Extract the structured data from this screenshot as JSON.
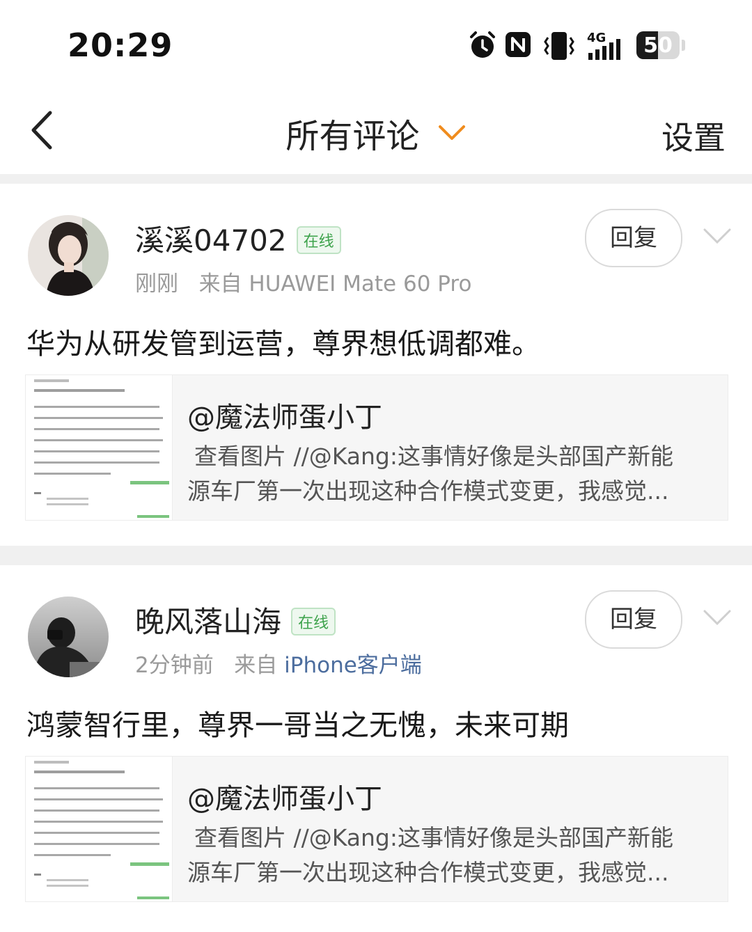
{
  "status_bar": {
    "time": "20:29",
    "network": "4G",
    "battery": "50",
    "battery_level_percent": 50,
    "icons": [
      "alarm-icon",
      "nfc-icon",
      "vibrate-icon",
      "signal-icon",
      "battery-icon"
    ]
  },
  "nav": {
    "back_icon": "chevron-left-icon",
    "title": "所有评论",
    "title_dropdown_icon": "chevron-down-icon",
    "dropdown_color": "#f08c1e",
    "settings_label": "设置"
  },
  "comments": [
    {
      "username": "溪溪04702",
      "online_badge": "在线",
      "time": "刚刚",
      "source": "来自 HUAWEI Mate 60 Pro",
      "reply_label": "回复",
      "text": "华为从研发管到运营，尊界想低调都难。",
      "quote": {
        "author": "@魔法师蛋小丁",
        "line1": "查看图片 //@Kang:这事情好像是头部国产新能",
        "line2": "源车厂第一次出现这种合作模式变更，我感觉..."
      }
    },
    {
      "username": "晚风落山海",
      "online_badge": "在线",
      "time": "2分钟前",
      "source_prefix": "来自",
      "source_link": "iPhone客户端",
      "reply_label": "回复",
      "text": "鸿蒙智行里，尊界一哥当之无愧，未来可期",
      "quote": {
        "author": "@魔法师蛋小丁",
        "line1": "查看图片 //@Kang:这事情好像是头部国产新能",
        "line2": "源车厂第一次出现这种合作模式变更，我感觉..."
      }
    }
  ],
  "colors": {
    "online_green": "#3fa34d",
    "link_blue": "#4c6d9e",
    "accent_orange": "#f08c1e"
  }
}
